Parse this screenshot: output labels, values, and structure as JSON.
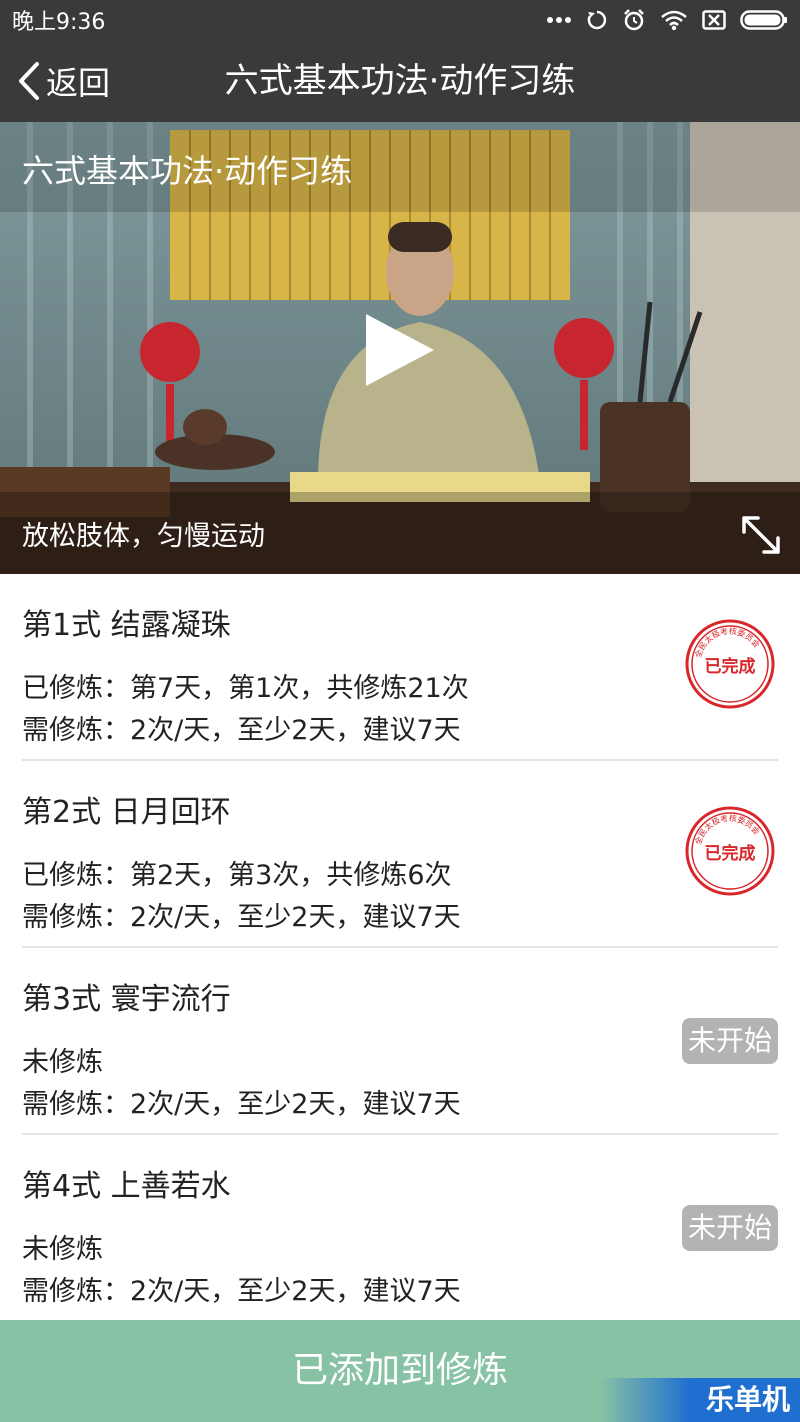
{
  "status_bar": {
    "time": "晚上9:36",
    "icons": [
      "more-icon",
      "sync-icon",
      "alarm-icon",
      "wifi-icon",
      "no-sim-icon",
      "battery-icon"
    ]
  },
  "nav": {
    "back_label": "返回",
    "title": "六式基本功法·动作习练"
  },
  "video": {
    "title": "六式基本功法·动作习练",
    "caption": "放松肢体，匀慢运动"
  },
  "items": [
    {
      "title": "第1式 结露凝珠",
      "line1": "已修炼：第7天，第1次，共修炼21次",
      "line2": "需修炼：2次/天，至少2天，建议7天",
      "status": "completed-stamp"
    },
    {
      "title": "第2式 日月回环",
      "line1": "已修炼：第2天，第3次，共修炼6次",
      "line2": "需修炼：2次/天，至少2天，建议7天",
      "status": "completed-stamp"
    },
    {
      "title": "第3式 寰宇流行",
      "line1": "未修炼",
      "line2": "需修炼：2次/天，至少2天，建议7天",
      "badge": "未开始"
    },
    {
      "title": "第4式 上善若水",
      "line1": "未修炼",
      "line2": "需修炼：2次/天，至少2天，建议7天",
      "badge": "未开始"
    }
  ],
  "stamp": {
    "outer_text": "全民太极考核委员会",
    "inner_text": "已完成"
  },
  "bottom_button": {
    "label": "已添加到修炼"
  },
  "watermark": {
    "text": "乐单机"
  },
  "colors": {
    "nav_bg": "#3a3a3a",
    "button_bg": "#88c2a4",
    "badge_bg": "#b3b3b3",
    "stamp_red": "#d8262b"
  }
}
